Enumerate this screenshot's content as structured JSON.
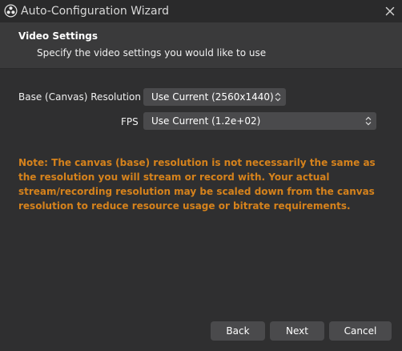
{
  "window": {
    "title": "Auto-Configuration Wizard",
    "icon": "obs-logo-icon",
    "close_icon": "close-icon"
  },
  "header": {
    "title": "Video Settings",
    "subtitle": "Specify the video settings you would like to use"
  },
  "form": {
    "resolution": {
      "label": "Base (Canvas) Resolution",
      "value": "Use Current (2560x1440)"
    },
    "fps": {
      "label": "FPS",
      "value": "Use Current (1.2e+02)"
    }
  },
  "note": {
    "text": "Note: The canvas (base) resolution is not necessarily the same as the resolution you will stream or record with. Your actual stream/recording resolution may be scaled down from the canvas resolution to reduce resource usage or bitrate requirements.",
    "color": "#d5821c"
  },
  "buttons": {
    "back": "Back",
    "next": "Next",
    "cancel": "Cancel"
  },
  "colors": {
    "background": "#2f2f30",
    "header_background": "#3a3a3b",
    "control_background": "#4a4a4c",
    "text": "#ffffff"
  }
}
